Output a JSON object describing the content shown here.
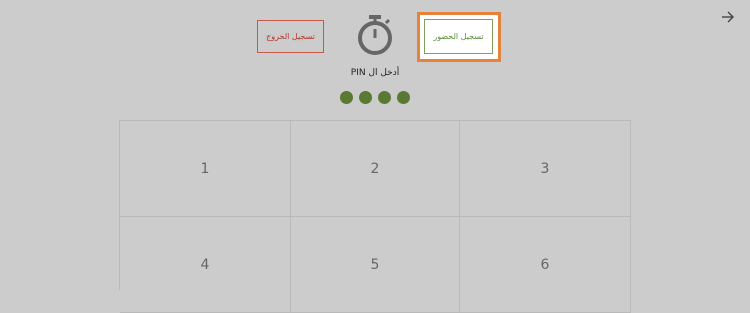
{
  "header": {
    "back_icon": "arrow-right-icon",
    "checkout_label": "تسجيل الخروج",
    "checkin_label": "تسجيل الحضور",
    "timer_icon": "stopwatch-icon"
  },
  "pin": {
    "label": "أدخل ال PIN",
    "dot_count": 4,
    "dot_color": "#5a7a34"
  },
  "keypad": {
    "keys": [
      "1",
      "2",
      "3",
      "4",
      "5",
      "6"
    ]
  },
  "colors": {
    "background": "#cccccc",
    "checkout_accent": "#c85a4a",
    "checkin_accent": "#7ea05a",
    "highlight": "#e8823a"
  }
}
